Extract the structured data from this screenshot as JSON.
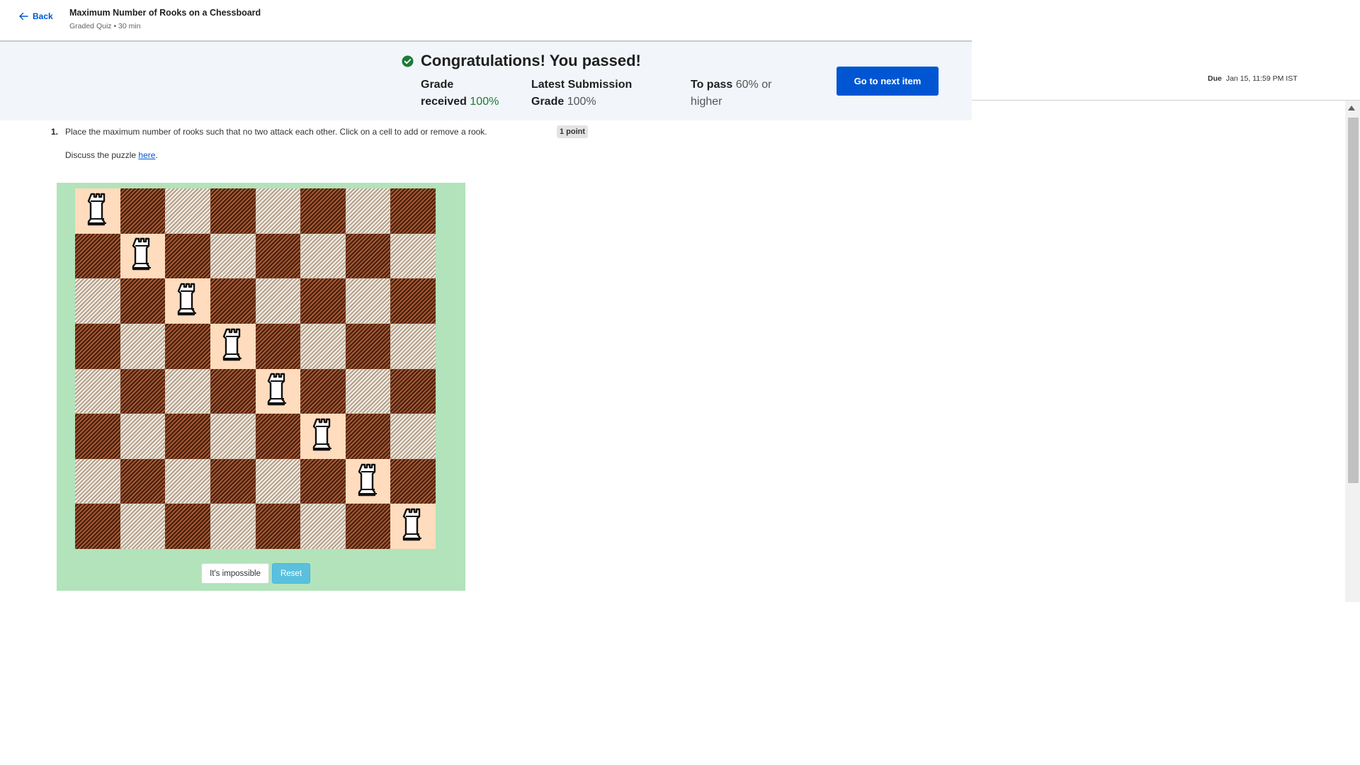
{
  "header": {
    "back_label": "Back",
    "title": "Maximum Number of Rooks on a Chessboard",
    "meta": "Graded Quiz • 30 min"
  },
  "banner": {
    "title": "Congratulations! You passed!",
    "grade_label_1": "Grade",
    "grade_label_2": "received",
    "grade_value": "100%",
    "latest_label_1": "Latest Submission",
    "latest_label_2": "Grade",
    "latest_value": "100%",
    "pass_label": "To pass",
    "pass_value": "60% or",
    "pass_value_2": "higher",
    "next_button": "Go to next item",
    "accent_color": "#0056d2",
    "success_color": "#1e7a3a"
  },
  "due": {
    "label": "Due",
    "value": "Jan 15, 11:59 PM IST"
  },
  "question": {
    "number": "1.",
    "text": "Place the maximum number of rooks such that no two attack each other. Click on a cell to add or remove a rook.",
    "points": "1 point",
    "discuss_prefix": "Discuss the puzzle ",
    "discuss_link": "here",
    "discuss_suffix": "."
  },
  "board": {
    "size": 8,
    "rooks": [
      [
        0,
        0
      ],
      [
        1,
        1
      ],
      [
        2,
        2
      ],
      [
        3,
        3
      ],
      [
        4,
        4
      ],
      [
        5,
        5
      ],
      [
        6,
        6
      ],
      [
        7,
        7
      ]
    ],
    "colors": {
      "panel": "#b2e3bb",
      "rook_cell": "#ffdcbd",
      "dark": "#4a2410",
      "light": "#f2ede6"
    }
  },
  "buttons": {
    "impossible": "It's impossible",
    "reset": "Reset"
  }
}
